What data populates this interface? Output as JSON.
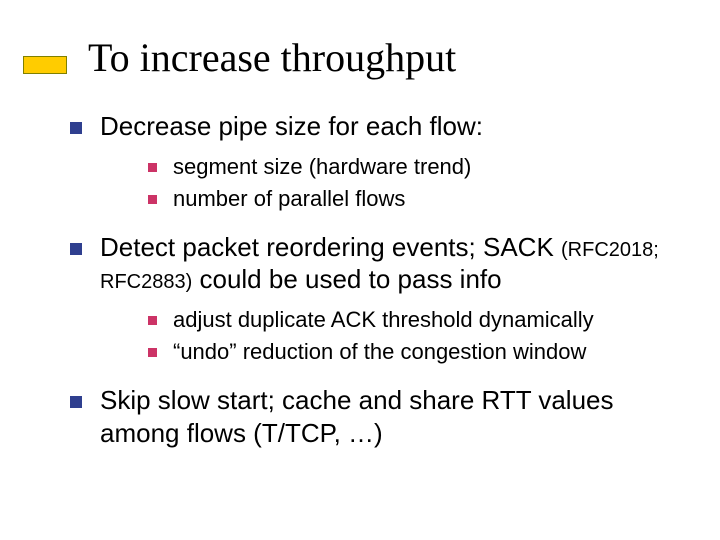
{
  "title": "To increase throughput",
  "points": {
    "p1": {
      "text": "Decrease pipe size for each flow:",
      "sub": {
        "s1": "segment size (hardware trend)",
        "s2": "number of parallel flows"
      }
    },
    "p2": {
      "text_a": "Detect packet reordering events; SACK ",
      "text_small": "(RFC2018; RFC2883)",
      "text_b": " could be used to pass info",
      "sub": {
        "s1": "adjust duplicate ACK threshold dynamically",
        "s2": "“undo” reduction of the congestion window"
      }
    },
    "p3": {
      "text": "Skip slow start; cache and share RTT values among flows (T/TCP, …)"
    }
  }
}
